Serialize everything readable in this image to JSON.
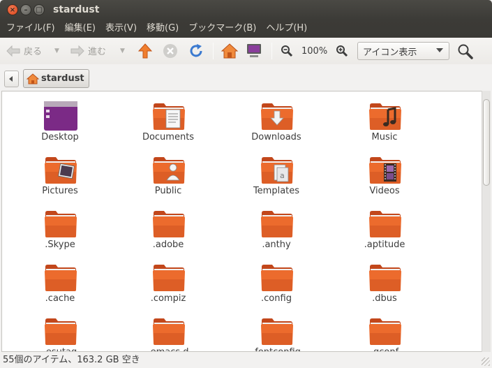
{
  "window": {
    "title": "stardust"
  },
  "menubar": [
    "ファイル(F)",
    "編集(E)",
    "表示(V)",
    "移動(G)",
    "ブックマーク(B)",
    "ヘルプ(H)"
  ],
  "toolbar": {
    "back_label": "戻る",
    "forward_label": "進む",
    "zoom_level": "100%",
    "view_mode": "アイコン表示"
  },
  "location": {
    "crumb": "stardust"
  },
  "colors": {
    "folder_main": "#ec6b2d",
    "folder_dark": "#c2471b",
    "accent": "#dd4814",
    "titlebar": "#3c3b37"
  },
  "items": [
    {
      "name": "Desktop",
      "icon": "desktop-folder-icon"
    },
    {
      "name": "Documents",
      "icon": "documents-folder-icon"
    },
    {
      "name": "Downloads",
      "icon": "downloads-folder-icon"
    },
    {
      "name": "Music",
      "icon": "music-folder-icon"
    },
    {
      "name": "Pictures",
      "icon": "pictures-folder-icon"
    },
    {
      "name": "Public",
      "icon": "public-folder-icon"
    },
    {
      "name": "Templates",
      "icon": "templates-folder-icon"
    },
    {
      "name": "Videos",
      "icon": "videos-folder-icon"
    },
    {
      "name": ".Skype",
      "icon": "folder-icon"
    },
    {
      "name": ".adobe",
      "icon": "folder-icon"
    },
    {
      "name": ".anthy",
      "icon": "folder-icon"
    },
    {
      "name": ".aptitude",
      "icon": "folder-icon"
    },
    {
      "name": ".cache",
      "icon": "folder-icon"
    },
    {
      "name": ".compiz",
      "icon": "folder-icon"
    },
    {
      "name": ".config",
      "icon": "folder-icon"
    },
    {
      "name": ".dbus",
      "icon": "folder-icon"
    },
    {
      "name": ".esutag",
      "icon": "folder-icon"
    },
    {
      "name": ".emacs.d",
      "icon": "folder-icon"
    },
    {
      "name": ".fontconfig",
      "icon": "folder-icon"
    },
    {
      "name": ".gconf",
      "icon": "folder-icon"
    }
  ],
  "status": {
    "text": "55個のアイテム、163.2 GB 空き"
  }
}
